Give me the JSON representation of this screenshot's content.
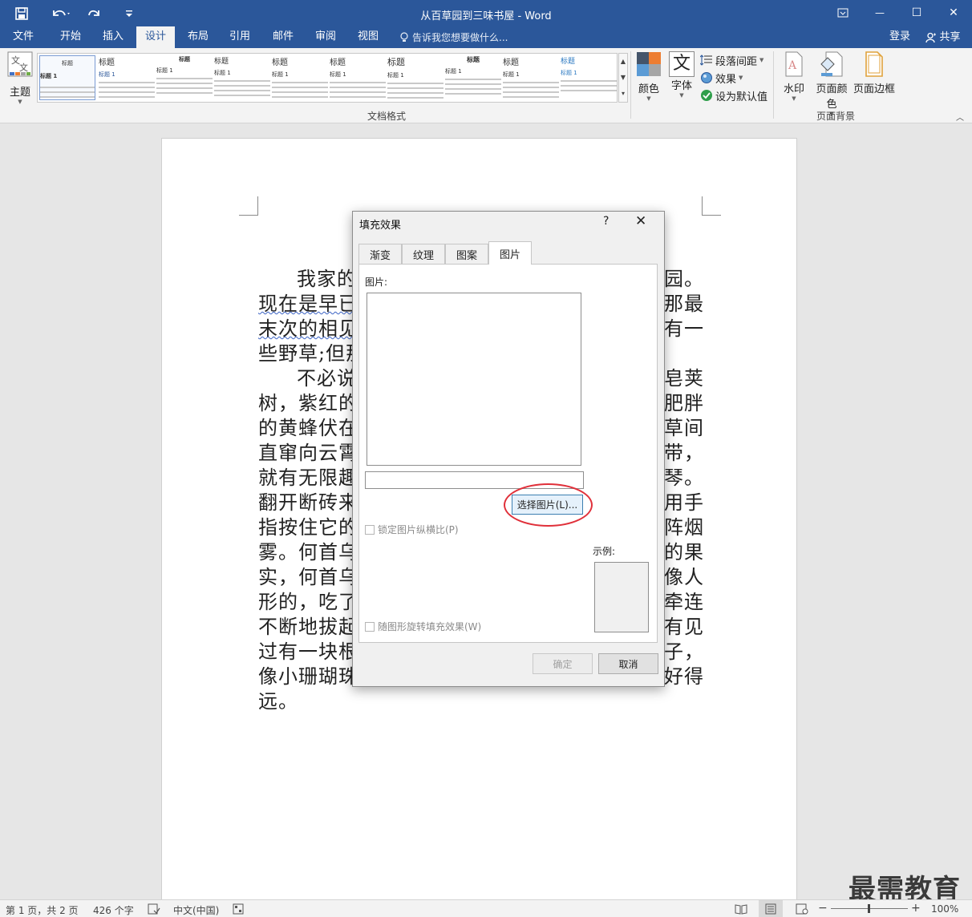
{
  "titlebar": {
    "title": "从百草园到三味书屋 - Word",
    "save_icon": "save-icon",
    "undo_icon": "undo-icon",
    "redo_icon": "redo-icon",
    "customize_icon": "customize-qat-icon",
    "ribbon_display_icon": "ribbon-display-icon",
    "minimize": "—",
    "maximize": "☐",
    "close": "✕"
  },
  "menu": {
    "tabs": [
      {
        "label": "文件"
      },
      {
        "label": "开始"
      },
      {
        "label": "插入"
      },
      {
        "label": "设计"
      },
      {
        "label": "布局"
      },
      {
        "label": "引用"
      },
      {
        "label": "邮件"
      },
      {
        "label": "审阅"
      },
      {
        "label": "视图"
      }
    ],
    "active_tab": "设计",
    "tell_me": "告诉我您想要做什么...",
    "login": "登录",
    "share": "共享"
  },
  "ribbon": {
    "theme_label": "主题",
    "gallery_items": [
      {
        "head": "标题",
        "sub": "标题 1"
      },
      {
        "head": "标题",
        "sub": "标题 1"
      },
      {
        "head": "标题",
        "sub": "标题 1"
      },
      {
        "head": "标题",
        "sub": "标题 1"
      },
      {
        "head": "标题",
        "sub": "标题 1"
      },
      {
        "head": "标题",
        "sub": "标题 1"
      },
      {
        "head": "标题",
        "sub": "标题 1"
      },
      {
        "head": "标题",
        "sub": "标题 1"
      },
      {
        "head": "标题",
        "sub": "标题 1"
      },
      {
        "head": "标题",
        "sub": "标题 1"
      }
    ],
    "group_doc_format": "文档格式",
    "colors_label": "颜色",
    "fonts_label": "字体",
    "fonts_glyph": "文",
    "paragraph_spacing": "段落间距",
    "effects": "效果",
    "set_default": "设为默认值",
    "watermark": "水印",
    "page_color": "页面颜色",
    "page_borders": "页面边框",
    "group_page_background": "页面背景",
    "accent_colors": [
      "#4472c4",
      "#ed7d31",
      "#a5a5a5",
      "#5b9bd5",
      "#2b579a"
    ]
  },
  "document": {
    "lines": [
      {
        "text": "我家的",
        "tail": "园。",
        "indent": true
      },
      {
        "text": "现在是早已",
        "tail": "那最",
        "squig": true
      },
      {
        "text": "末次的相见",
        "tail": "有一",
        "squig": true
      },
      {
        "text": "些野草;但那",
        "tail": ""
      },
      {
        "text": "不必说",
        "tail": "皂荚",
        "indent": true
      },
      {
        "text": "树，紫红的",
        "tail": "肥胖"
      },
      {
        "text": "的黄蜂伏在",
        "tail": "草间"
      },
      {
        "text": "直窜向云霄",
        "tail": "带，"
      },
      {
        "text": "就有无限趣",
        "tail": "琴。"
      },
      {
        "text": "翻开断砖来",
        "tail": "用手"
      },
      {
        "text": "指按住它的",
        "tail": "阵烟"
      },
      {
        "text": "雾。何首乌",
        "tail": "的果"
      },
      {
        "text": "实，何首乌",
        "tail": "像人"
      },
      {
        "text": "形的，吃了",
        "tail": "牵连"
      },
      {
        "text": "不断地拔起",
        "tail": "有见"
      },
      {
        "text": "过有一块根",
        "tail": "子，"
      },
      {
        "text": "像小珊瑚珠",
        "tail": "好得"
      },
      {
        "text": "远。",
        "tail": ""
      }
    ]
  },
  "dialog": {
    "title": "填充效果",
    "help": "?",
    "close": "✕",
    "tabs": [
      {
        "label": "渐变"
      },
      {
        "label": "纹理"
      },
      {
        "label": "图案"
      },
      {
        "label": "图片"
      }
    ],
    "active_tab": "图片",
    "picture_label": "图片:",
    "path_value": "",
    "select_button": "选择图片(L)...",
    "lock_aspect": "锁定图片纵横比(P)",
    "sample_label": "示例:",
    "rotate_with_shape": "随图形旋转填充效果(W)",
    "ok": "确定",
    "cancel": "取消"
  },
  "status": {
    "page": "第 1 页，共 2 页",
    "words": "426 个字",
    "lang": "中文(中国)",
    "zoom": "100%",
    "zoom_minus": "−",
    "zoom_plus": "+"
  },
  "brand_watermark": "最需教育"
}
